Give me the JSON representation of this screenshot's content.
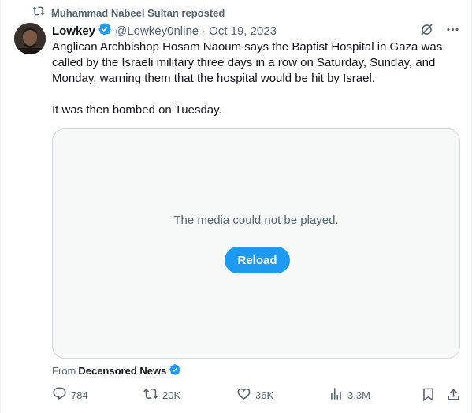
{
  "repost": {
    "icon": "repost-icon",
    "text": "Muhammad Nabeel Sultan reposted"
  },
  "author": {
    "name": "Lowkey",
    "handle": "@Lowkey0nline",
    "separator": "·",
    "date": "Oct 19, 2023",
    "verified_color": "#1d9bf0"
  },
  "tweet": {
    "paragraphs": [
      "Anglican Archbishop Hosam Naoum says the Baptist Hospital in Gaza was called by the Israeli military three days in a row on Saturday, Sunday, and Monday, warning them that the hospital would be hit by Israel.",
      "It was then bombed on Tuesday."
    ]
  },
  "media": {
    "message": "The media could not be played.",
    "reload_label": "Reload",
    "accent": "#1d9bf0"
  },
  "source": {
    "prefix": "From",
    "name": "Decensored News"
  },
  "actions": {
    "replies": "784",
    "reposts": "20K",
    "likes": "36K",
    "views": "3.3M"
  },
  "colors": {
    "text": "#0f1419",
    "secondary": "#536471",
    "border": "#cfd9de",
    "media_bg": "#f7f9f9"
  }
}
